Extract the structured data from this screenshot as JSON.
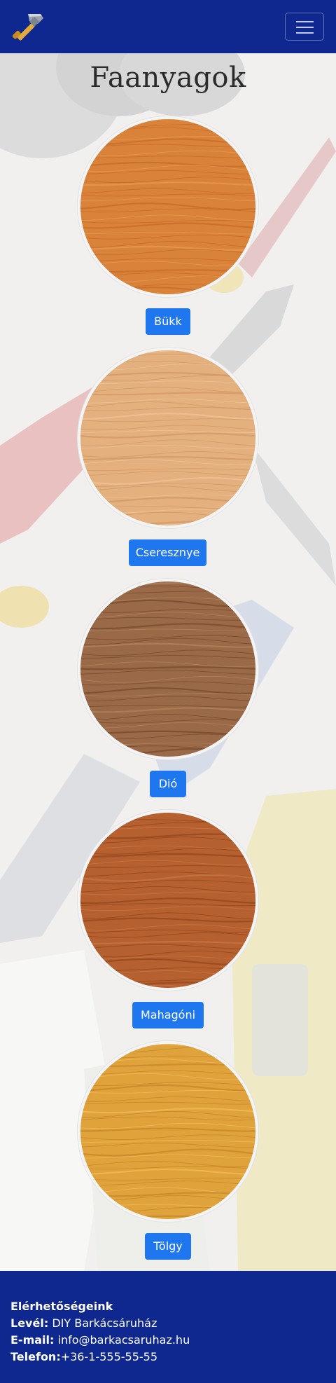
{
  "header": {
    "logo_icon": "hammer-icon",
    "menu_icon": "hamburger-menu-icon",
    "brand_color": "#0e2890"
  },
  "page": {
    "title": "Faanyagok"
  },
  "woods": [
    {
      "label": "Bükk",
      "base": "#d9823a",
      "grain": "#c56a28",
      "light": "#e89a55"
    },
    {
      "label": "Cseresznye",
      "base": "#e3b07e",
      "grain": "#cf9866",
      "light": "#efc59a"
    },
    {
      "label": "Dió",
      "base": "#9a6a48",
      "grain": "#73482d",
      "light": "#b3845f"
    },
    {
      "label": "Mahagóni",
      "base": "#b5602e",
      "grain": "#8f4420",
      "light": "#c97848"
    },
    {
      "label": "Tölgy",
      "base": "#e0a23a",
      "grain": "#c4842a",
      "light": "#efbf5c"
    }
  ],
  "button_color": "#1f77f0",
  "footer": {
    "heading": "Elérhetőségeink",
    "mail_label": "Levél:",
    "mail_value": "DIY Barkácsáruház",
    "email_label": "E-mail:",
    "email_value": "info@barkacsaruhaz.hu",
    "phone_label": "Telefon:",
    "phone_value": "+36-1-555-55-55"
  }
}
